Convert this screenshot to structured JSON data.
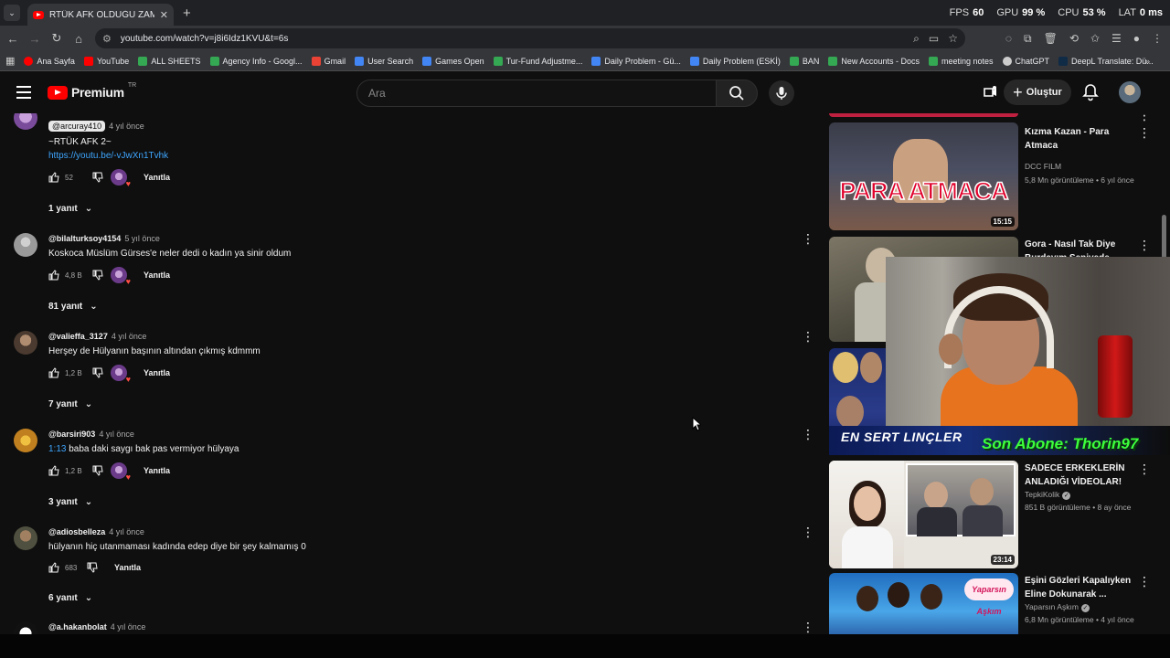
{
  "browser": {
    "tab_title": "RTÜK AFK OLDUĞU ZAMANLAR",
    "url": "youtube.com/watch?v=j8i6Idz1KVU&t=6s",
    "stats": [
      {
        "label": "FPS",
        "value": "60"
      },
      {
        "label": "GPU",
        "value": "99 %"
      },
      {
        "label": "CPU",
        "value": "53 %"
      },
      {
        "label": "LAT",
        "value": "0 ms"
      }
    ],
    "bookmarks": [
      {
        "label": "Ana Sayfa",
        "color": "#ff0000"
      },
      {
        "label": "YouTube",
        "color": "#ff0000"
      },
      {
        "label": "ALL SHEETS",
        "color": "#34a853"
      },
      {
        "label": "Agency Info - Googl...",
        "color": "#34a853"
      },
      {
        "label": "Gmail",
        "color": "#ea4335"
      },
      {
        "label": "User Search",
        "color": "#4285f4"
      },
      {
        "label": "Games Open",
        "color": "#4285f4"
      },
      {
        "label": "Tur-Fund Adjustme...",
        "color": "#34a853"
      },
      {
        "label": "Daily Problem - Gü...",
        "color": "#4285f4"
      },
      {
        "label": "Daily Problem (ESKİ)",
        "color": "#4285f4"
      },
      {
        "label": "BAN",
        "color": "#34a853"
      },
      {
        "label": "New Accounts - Docs",
        "color": "#34a853"
      },
      {
        "label": "meeting notes",
        "color": "#34a853"
      },
      {
        "label": "ChatGPT",
        "color": "#cccccc"
      },
      {
        "label": "DeepL Translate: Dü...",
        "color": "#0f2b46"
      }
    ]
  },
  "header": {
    "logo_text": "Premium",
    "logo_region": "TR",
    "search_placeholder": "Ara",
    "create_label": "Oluştur"
  },
  "comments": [
    {
      "handle": "@arcuray410",
      "time": "4 yıl önce",
      "text": "~RTÜK AFK 2~",
      "link": "https://youtu.be/-vJwXn1Tvhk",
      "likes": "52",
      "reply_label": "Yanıtla",
      "replies": "1 yanıt"
    },
    {
      "handle": "@bilalturksoy4154",
      "time": "5 yıl önce",
      "text": "Koskoca Müslüm Gürses'e neler dedi o kadın ya sinir oldum",
      "likes": "4,8 B",
      "reply_label": "Yanıtla",
      "replies": "81 yanıt"
    },
    {
      "handle": "@valieffa_3127",
      "time": "4 yıl önce",
      "text": "Herşey de Hülyanın başının altından çıkmış kdmmm",
      "likes": "1,2 B",
      "reply_label": "Yanıtla",
      "replies": "7 yanıt"
    },
    {
      "handle": "@barsiri903",
      "time": "4 yıl önce",
      "timestamp": "1:13",
      "text": " baba daki saygı bak pas vermiyor hülyaya",
      "likes": "1,2 B",
      "reply_label": "Yanıtla",
      "replies": "3 yanıt"
    },
    {
      "handle": "@adiosbelleza",
      "time": "4 yıl önce",
      "text": "hülyanın hiç utanmaması kadında edep diye bir şey kalmamış 0",
      "likes": "683",
      "reply_label": "Yanıtla",
      "replies": "6 yanıt"
    },
    {
      "handle": "@a.hakanbolat",
      "time": "4 yıl önce"
    }
  ],
  "recommendations": [
    {
      "title": "Kızma Kazan - Para Atmaca",
      "channel": "DCC FILM",
      "meta": "5,8 Mn görüntüleme • 6 yıl önce",
      "duration": "15:15",
      "thumb_text": "PARA ATMACA"
    },
    {
      "title": "Gora - Nasıl Tak Diye Burdayım Şenivede",
      "channel": "",
      "meta": "",
      "duration": ""
    },
    {
      "title": "",
      "channel": "",
      "meta": "",
      "duration": "",
      "thumb_text": "EN SERT LINÇLER"
    },
    {
      "title": "SADECE ERKEKLERİN ANLADIĞI VİDEOLAR!",
      "channel": "TepkiKolik",
      "meta": "851 B görüntüleme • 8 ay önce",
      "duration": "23:14"
    },
    {
      "title": "Eşini Gözleri Kapalıyken Eline Dokunarak ...",
      "channel": "Yaparsın Aşkım",
      "meta": "6,8 Mn görüntüleme • 4 yıl önce",
      "duration": "",
      "thumb_text": "Yaparsın Aşkım"
    }
  ],
  "overlay": {
    "alert_text": "Son Abone: Thorin97"
  }
}
